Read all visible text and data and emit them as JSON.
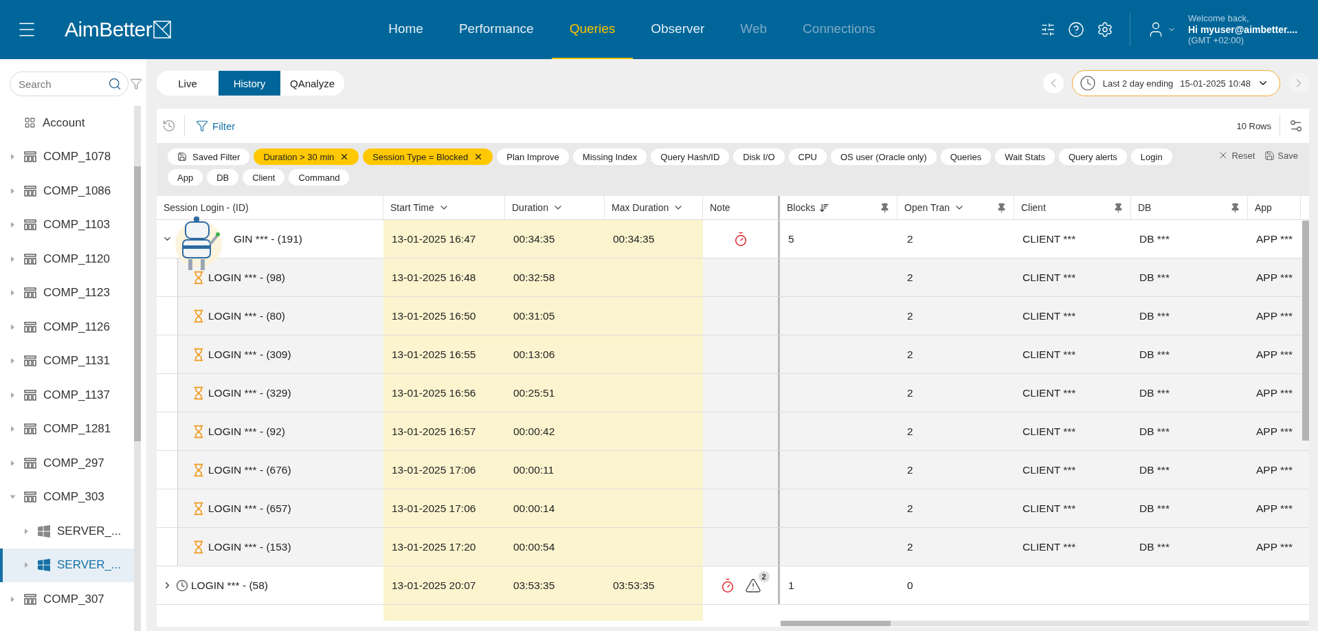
{
  "header": {
    "logo": "AimBetter",
    "nav": [
      {
        "label": "Home",
        "selected": false,
        "disabled": false
      },
      {
        "label": "Performance",
        "selected": false,
        "disabled": false
      },
      {
        "label": "Queries",
        "selected": true,
        "disabled": false
      },
      {
        "label": "Observer",
        "selected": false,
        "disabled": false
      },
      {
        "label": "Web",
        "selected": false,
        "disabled": true
      },
      {
        "label": "Connections",
        "selected": false,
        "disabled": true
      }
    ],
    "user": {
      "greeting": "Welcome back,",
      "name": "Hi myuser@aimbetter....",
      "timezone": "(GMT +02:00)"
    }
  },
  "sidebar": {
    "search": {
      "placeholder": "Search"
    },
    "items": [
      {
        "label": "Account",
        "kind": "account",
        "selected": false
      },
      {
        "label": "COMP_1078",
        "kind": "company",
        "expanded": false,
        "selected": false
      },
      {
        "label": "COMP_1086",
        "kind": "company",
        "expanded": false,
        "selected": false
      },
      {
        "label": "COMP_1103",
        "kind": "company",
        "expanded": false,
        "selected": false
      },
      {
        "label": "COMP_1120",
        "kind": "company",
        "expanded": false,
        "selected": false
      },
      {
        "label": "COMP_1123",
        "kind": "company",
        "expanded": false,
        "selected": false
      },
      {
        "label": "COMP_1126",
        "kind": "company",
        "expanded": false,
        "selected": false
      },
      {
        "label": "COMP_1131",
        "kind": "company",
        "expanded": false,
        "selected": false
      },
      {
        "label": "COMP_1137",
        "kind": "company",
        "expanded": false,
        "selected": false
      },
      {
        "label": "COMP_1281",
        "kind": "company",
        "expanded": false,
        "selected": false
      },
      {
        "label": "COMP_297",
        "kind": "company",
        "expanded": false,
        "selected": false
      },
      {
        "label": "COMP_303",
        "kind": "company",
        "expanded": true,
        "selected": false,
        "children": [
          {
            "label": "SERVER_...",
            "kind": "server",
            "expanded": false,
            "selected": false
          },
          {
            "label": "SERVER_...",
            "kind": "server",
            "expanded": false,
            "selected": true
          }
        ]
      },
      {
        "label": "COMP_307",
        "kind": "company",
        "expanded": false,
        "selected": false
      }
    ]
  },
  "view_tabs": [
    {
      "label": "Live",
      "selected": false
    },
    {
      "label": "History",
      "selected": true
    },
    {
      "label": "QAnalyze",
      "selected": false
    }
  ],
  "time_range": {
    "label": "Last 2 day ending",
    "value": "15-01-2025 10:48"
  },
  "toolbar": {
    "filter": "Filter",
    "row_count": "10 Rows"
  },
  "chips": [
    {
      "label": "Saved Filter",
      "kind": "saved",
      "active": false
    },
    {
      "label": "Duration > 30 min",
      "kind": "filter",
      "active": true
    },
    {
      "label": "Session Type = Blocked",
      "kind": "filter",
      "active": true
    },
    {
      "label": "Plan Improve",
      "kind": "filter",
      "active": false
    },
    {
      "label": "Missing Index",
      "kind": "filter",
      "active": false
    },
    {
      "label": "Query Hash/ID",
      "kind": "filter",
      "active": false
    },
    {
      "label": "Disk I/O",
      "kind": "filter",
      "active": false
    },
    {
      "label": "CPU",
      "kind": "filter",
      "active": false
    },
    {
      "label": "OS user (Oracle only)",
      "kind": "filter",
      "active": false
    },
    {
      "label": "Queries",
      "kind": "filter",
      "active": false
    },
    {
      "label": "Wait Stats",
      "kind": "filter",
      "active": false
    },
    {
      "label": "Query alerts",
      "kind": "filter",
      "active": false
    },
    {
      "label": "Login",
      "kind": "filter",
      "active": false
    },
    {
      "label": "App",
      "kind": "filter",
      "active": false
    },
    {
      "label": "DB",
      "kind": "filter",
      "active": false
    },
    {
      "label": "Client",
      "kind": "filter",
      "active": false
    },
    {
      "label": "Command",
      "kind": "filter",
      "active": false
    }
  ],
  "chip_actions": [
    "Reset",
    "Save"
  ],
  "table": {
    "columns": [
      {
        "label": "Session Login - (ID)",
        "kind": "plain",
        "pinned": false
      },
      {
        "label": "Start Time",
        "kind": "menu",
        "pinned": false
      },
      {
        "label": "Duration",
        "kind": "menu",
        "pinned": false
      },
      {
        "label": "Max Duration",
        "kind": "menu",
        "pinned": false
      },
      {
        "label": "Note",
        "kind": "plain",
        "pinned": false
      },
      {
        "label": "Blocks",
        "kind": "sorted",
        "pinned": true
      },
      {
        "label": "Open Tran",
        "kind": "menu",
        "pinned": true
      },
      {
        "label": "Client",
        "kind": "plain",
        "pinned": true
      },
      {
        "label": "DB",
        "kind": "plain",
        "pinned": true
      },
      {
        "label": "App",
        "kind": "plain",
        "pinned": false
      }
    ],
    "rows": [
      {
        "login": "GIN *** - (191)",
        "start": "13-01-2025 16:47",
        "duration": "00:34:35",
        "max_duration": "00:34:35",
        "notes": [
          {
            "kind": "timer"
          }
        ],
        "blocks": "5",
        "open_tran": "2",
        "client": "CLIENT ***",
        "db": "DB ***",
        "app": "APP ***",
        "expanded": true,
        "children": [
          {
            "login": "LOGIN *** - (98)",
            "start": "13-01-2025 16:48",
            "duration": "00:32:58",
            "open_tran": "2",
            "client": "CLIENT ***",
            "db": "DB ***",
            "app": "APP ***"
          },
          {
            "login": "LOGIN *** - (80)",
            "start": "13-01-2025 16:50",
            "duration": "00:31:05",
            "open_tran": "2",
            "client": "CLIENT ***",
            "db": "DB ***",
            "app": "APP ***"
          },
          {
            "login": "LOGIN *** - (309)",
            "start": "13-01-2025 16:55",
            "duration": "00:13:06",
            "open_tran": "2",
            "client": "CLIENT ***",
            "db": "DB ***",
            "app": "APP ***"
          },
          {
            "login": "LOGIN *** - (329)",
            "start": "13-01-2025 16:56",
            "duration": "00:25:51",
            "open_tran": "2",
            "client": "CLIENT ***",
            "db": "DB ***",
            "app": "APP ***"
          },
          {
            "login": "LOGIN *** - (92)",
            "start": "13-01-2025 16:57",
            "duration": "00:00:42",
            "open_tran": "2",
            "client": "CLIENT ***",
            "db": "DB ***",
            "app": "APP ***"
          },
          {
            "login": "LOGIN *** - (676)",
            "start": "13-01-2025 17:06",
            "duration": "00:00:11",
            "open_tran": "2",
            "client": "CLIENT ***",
            "db": "DB ***",
            "app": "APP ***"
          },
          {
            "login": "LOGIN *** - (657)",
            "start": "13-01-2025 17:06",
            "duration": "00:00:14",
            "open_tran": "2",
            "client": "CLIENT ***",
            "db": "DB ***",
            "app": "APP ***"
          },
          {
            "login": "LOGIN *** - (153)",
            "start": "13-01-2025 17:20",
            "duration": "00:00:54",
            "open_tran": "2",
            "client": "CLIENT ***",
            "db": "DB ***",
            "app": "APP ***"
          }
        ]
      },
      {
        "login": "LOGIN *** - (58)",
        "start": "13-01-2025 20:07",
        "duration": "03:53:35",
        "max_duration": "03:53:35",
        "notes": [
          {
            "kind": "timer"
          },
          {
            "kind": "warning",
            "badge": "2"
          }
        ],
        "blocks": "1",
        "open_tran": "0",
        "expanded": false,
        "kind": "blocked"
      }
    ]
  }
}
